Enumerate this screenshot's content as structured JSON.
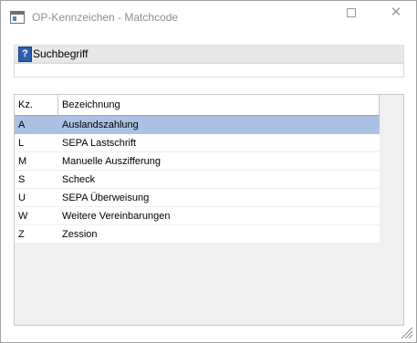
{
  "window": {
    "title": "OP-Kennzeichen - Matchcode",
    "close_glyph": "✕",
    "app_icon": "window-icon",
    "maximize_icon": "maximize-icon"
  },
  "search": {
    "label": "Suchbegriff",
    "help_glyph": "?",
    "help_icon": "help-icon",
    "value": "",
    "placeholder": ""
  },
  "grid": {
    "columns": [
      "Kz.",
      "Bezeichnung"
    ],
    "rows": [
      {
        "kz": "A",
        "bezeichnung": "Auslandszahlung",
        "selected": true
      },
      {
        "kz": "L",
        "bezeichnung": "SEPA Lastschrift",
        "selected": false
      },
      {
        "kz": "M",
        "bezeichnung": "Manuelle Auszifferung",
        "selected": false
      },
      {
        "kz": "S",
        "bezeichnung": "Scheck",
        "selected": false
      },
      {
        "kz": "U",
        "bezeichnung": "SEPA Überweisung",
        "selected": false
      },
      {
        "kz": "W",
        "bezeichnung": "Weitere Vereinbarungen",
        "selected": false
      },
      {
        "kz": "Z",
        "bezeichnung": "Zession",
        "selected": false
      }
    ]
  },
  "colors": {
    "selected_row": "#aac1e4",
    "help_icon_bg": "#2b5fb4",
    "title_text": "#8e8e8e"
  }
}
